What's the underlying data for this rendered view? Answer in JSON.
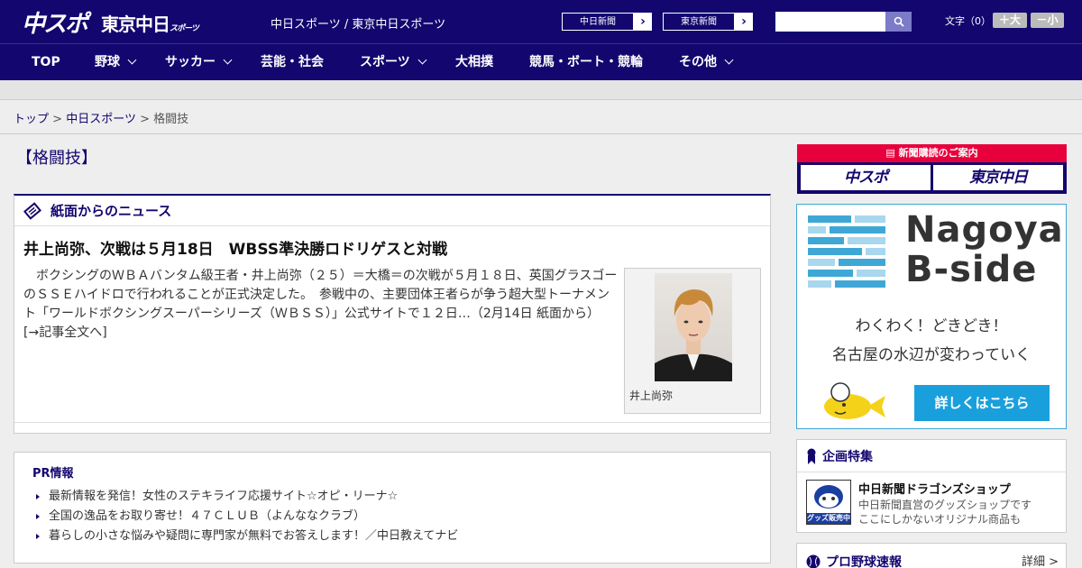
{
  "header": {
    "logo_chunichi": "中スポ",
    "logo_tokyo": "東京中日",
    "logo_tokyo_small": "スポーツ",
    "site_links": "中日スポーツ / 東京中日スポーツ",
    "paper1": "中日新聞",
    "paper2": "東京新聞",
    "search_placeholder": "",
    "font_label": "文字（0）",
    "font_bigger": "＋大",
    "font_smaller": "－小"
  },
  "nav": {
    "items": [
      "TOP",
      "野球",
      "サッカー",
      "芸能・社会",
      "スポーツ",
      "大相撲",
      "競馬・ボート・競輪",
      "その他"
    ]
  },
  "breadcrumb": {
    "top": "トップ",
    "sep": ">",
    "chunichi": "中日スポーツ",
    "current": "格闘技"
  },
  "section_title": "【格闘技】",
  "news": {
    "box_title": "紙面からのニュース",
    "headline": "井上尚弥、次戦は５月18日　WBSS準決勝ロドリゲスと対戦",
    "body": "　ボクシングのＷＢＡバンタム級王者・井上尚弥（２５）＝大橋＝の次戦が５月１８日、英国グラスゴーのＳＳＥハイドロで行われることが正式決定した。　参戦中の、主要団体王者らが争う超大型トーナメント「ワールドボクシングスーパーシリーズ（ＷＢＳＳ）」公式サイトで１２日…（2月14日 紙面から）　[→記事全文へ]",
    "photo_caption": "井上尚弥"
  },
  "pr": {
    "title": "PR情報",
    "items": [
      "最新情報を発信！女性のステキライフ応援サイト☆オピ・リーナ☆",
      "全国の逸品をお取り寄せ！４７ＣＬＵＢ（よんななクラブ）",
      "暮らしの小さな悩みや疑問に専門家が無料でお答えします！／中日教えてナビ"
    ]
  },
  "subscription": {
    "title": "新聞購読のご案内",
    "btn1": "中スポ",
    "btn2": "東京中日"
  },
  "ad": {
    "name_line1": "Nagoya",
    "name_line2": "B-side",
    "tag1": "わくわく！どきどき！",
    "tag2": "名古屋の水辺が変わっていく",
    "button": "詳しくはこちら"
  },
  "kikaku": {
    "title": "企画特集",
    "item_title": "中日新聞ドラゴンズショップ",
    "item_desc1": "中日新聞直営のグッズショップです",
    "item_desc2": "ここにしかないオリジナル商品も",
    "badge": "グッズ販売中"
  },
  "sokuhou": {
    "title": "プロ野球速報",
    "more": "詳細 >"
  },
  "colors": {
    "navy": "#13066e",
    "red": "#e8003c",
    "blue": "#19a0dc"
  }
}
